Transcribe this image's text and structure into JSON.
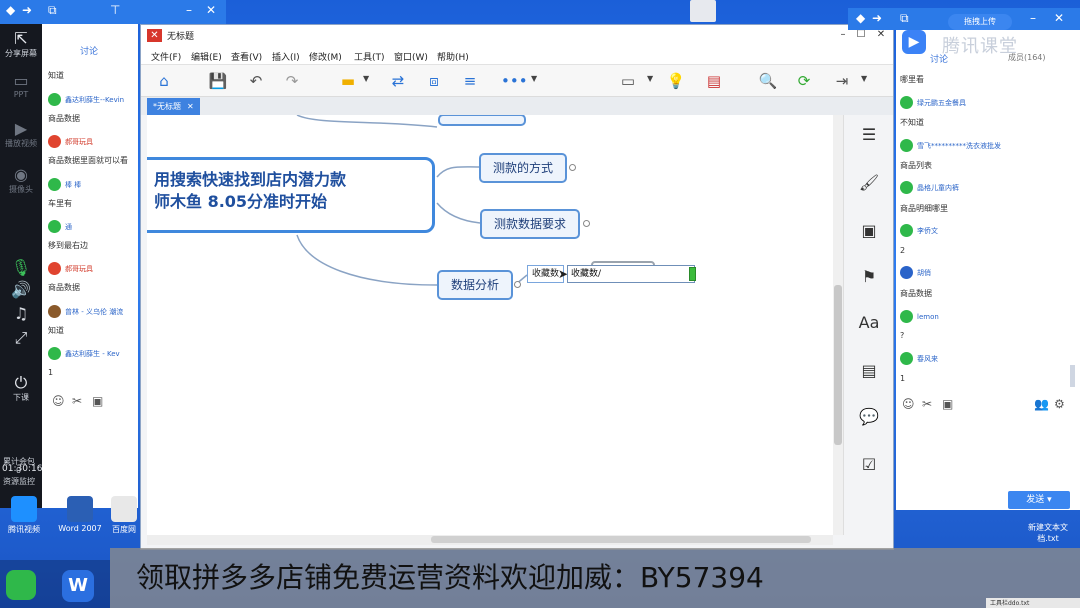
{
  "left_toolbar": {
    "share_label": "分享屏幕",
    "ppt_label": "PPT",
    "video_label": "播放视频",
    "camera_label": "摄像头",
    "class_end_label": "下课",
    "clock": "01:30:16",
    "stat1": "累计会包",
    "stat2": "0",
    "stat3": "资源监控"
  },
  "left_chat": {
    "tab_label": "讨论",
    "messages": [
      {
        "user": "",
        "text": "知道"
      },
      {
        "user": "鑫达利薛生--Kevin",
        "text": "商品数据",
        "color": "wechat"
      },
      {
        "user": "郝哥玩具",
        "text": "商品数据里面就可以看",
        "color": "red"
      },
      {
        "user": "棒 棒",
        "text": "车里有",
        "color": "wechat"
      },
      {
        "user": "通",
        "text": "移到最右边",
        "color": "wechat"
      },
      {
        "user": "郝哥玩具",
        "text": "商品数据",
        "color": "red"
      },
      {
        "user": "曾林 - 义乌伦 潮流",
        "text": "知道",
        "color": "brown"
      },
      {
        "user": "鑫达利薛生 - Kev",
        "text": "1",
        "color": "wechat"
      }
    ]
  },
  "window": {
    "title": "无标题",
    "menus": [
      "文件(F)",
      "编辑(E)",
      "查看(V)",
      "插入(I)",
      "修改(M)",
      "工具(T)",
      "窗口(W)",
      "帮助(H)"
    ],
    "doc_tab": "*无标题"
  },
  "mindmap": {
    "central_line1": "用搜索快速找到店内潜力款",
    "central_line2": "师木鱼 8.05分准时开始",
    "topic1": "测款的方式",
    "topic2": "测款数据要求",
    "topic3": "数据分析",
    "sub1": "收藏数",
    "edit_value": "收藏数/"
  },
  "right_chat": {
    "upload_label": "拖拽上传",
    "watermark": "腾讯课堂",
    "tab_label": "讨论",
    "member_count": "成员(164)",
    "messages": [
      {
        "user": "",
        "text": "哪里看"
      },
      {
        "user": "绿元鹏五金餐具",
        "text": "不知道",
        "color": "wechat"
      },
      {
        "user": "雪飞**********洗衣液批发",
        "text": "商品列表",
        "color": "wechat"
      },
      {
        "user": "晶格儿童内裤",
        "text": "商品明细哪里",
        "color": "wechat"
      },
      {
        "user": "李侨文",
        "text": "2",
        "color": "wechat"
      },
      {
        "user": "胡俏",
        "text": "商品数据",
        "color": "blue"
      },
      {
        "user": "lemon",
        "text": "?",
        "color": "wechat"
      },
      {
        "user": "春风来",
        "text": "1",
        "color": "wechat"
      }
    ],
    "send_label": "发送"
  },
  "desktop": {
    "icon1": "腾讯视频",
    "icon2": "Word 2007",
    "icon3": "百度网",
    "txt_file": "新建文本文档.txt",
    "corner_note": "工具栏ddo.txt"
  },
  "banner_text": "领取拼多多店铺免费运营资料欢迎加威：BY57394"
}
